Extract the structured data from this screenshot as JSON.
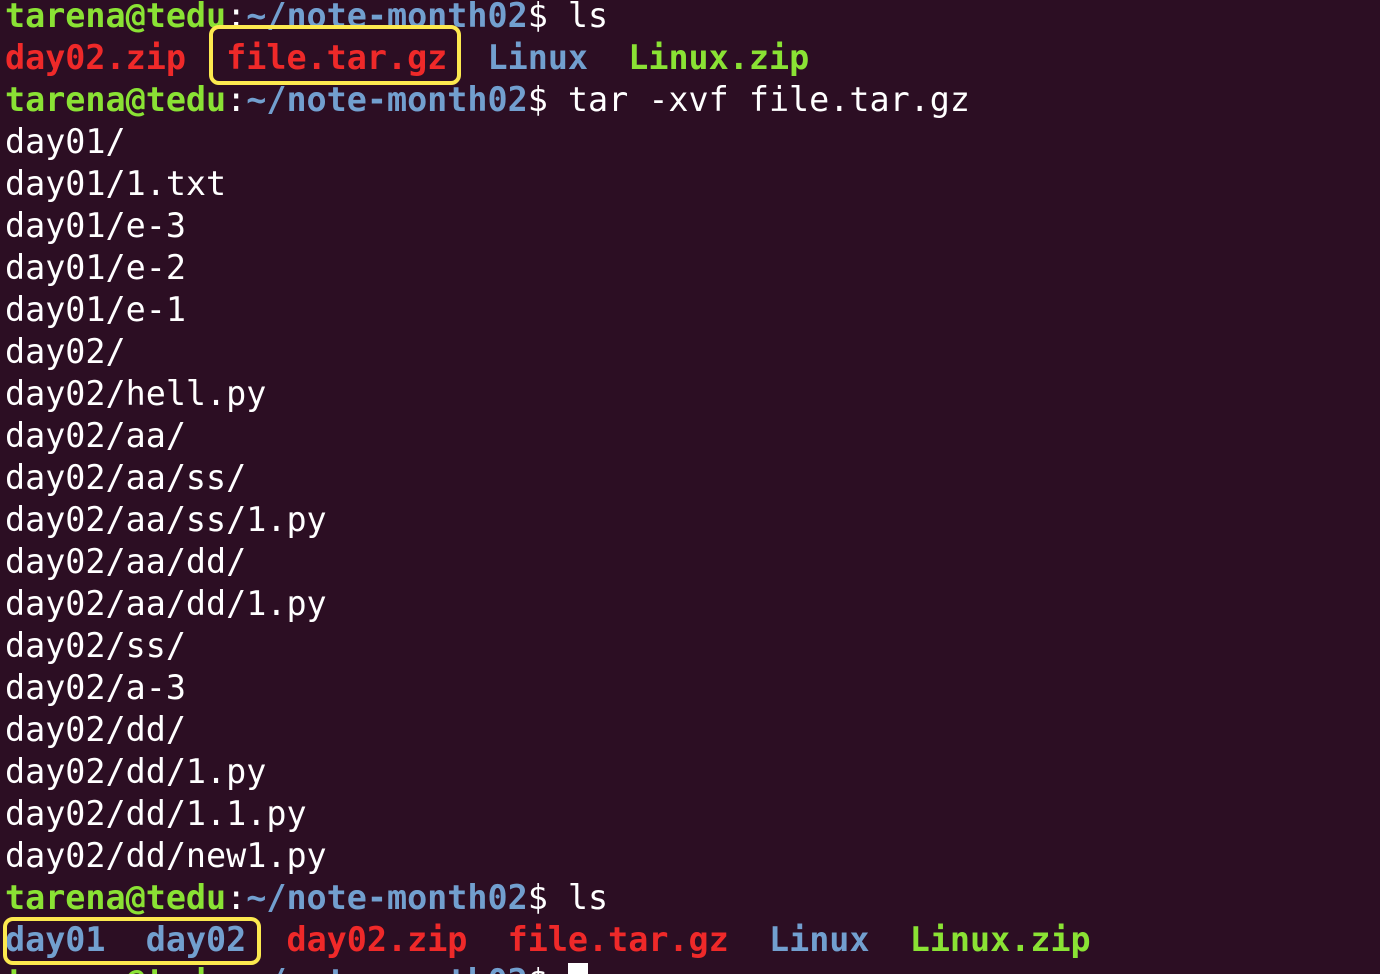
{
  "prompt": {
    "user_host": "tarena@tedu",
    "colon": ":",
    "path": "~/note-month02",
    "dollar": "$ "
  },
  "commands": {
    "ls1": "ls",
    "tar": "tar -xvf file.tar.gz",
    "ls2": "ls"
  },
  "ls1_files": [
    {
      "name": "day02.zip",
      "kind": "archive"
    },
    {
      "name": "file.tar.gz",
      "kind": "archive"
    },
    {
      "name": "Linux",
      "kind": "dir"
    },
    {
      "name": "Linux.zip",
      "kind": "zip"
    }
  ],
  "tar_output": [
    "day01/",
    "day01/1.txt",
    "day01/e-3",
    "day01/e-2",
    "day01/e-1",
    "day02/",
    "day02/hell.py",
    "day02/aa/",
    "day02/aa/ss/",
    "day02/aa/ss/1.py",
    "day02/aa/dd/",
    "day02/aa/dd/1.py",
    "day02/ss/",
    "day02/a-3",
    "day02/dd/",
    "day02/dd/1.py",
    "day02/dd/1.1.py",
    "day02/dd/new1.py"
  ],
  "ls2_files": [
    {
      "name": "day01",
      "kind": "dir"
    },
    {
      "name": "day02",
      "kind": "dir"
    },
    {
      "name": "day02.zip",
      "kind": "archive"
    },
    {
      "name": "file.tar.gz",
      "kind": "archive"
    },
    {
      "name": "Linux",
      "kind": "dir"
    },
    {
      "name": "Linux.zip",
      "kind": "zip"
    }
  ],
  "colors": {
    "background": "#2c0e23",
    "user_host": "#8ae234",
    "path": "#729fcf",
    "archive": "#ef2929",
    "directory": "#729fcf",
    "zip_green": "#8ae234",
    "highlight_box": "#fce94f"
  }
}
